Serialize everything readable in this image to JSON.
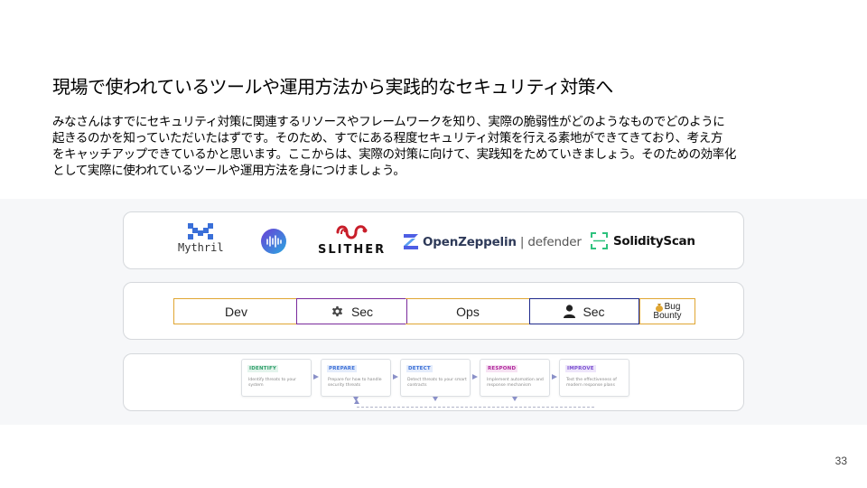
{
  "slide": {
    "title": "現場で使われているツールや運用方法から実践的なセキュリティ対策へ",
    "body_lines": [
      "みなさんはすでにセキュリティ対策に関連するリソースやフレームワークを知り、実際の脆弱性がどのようなものでどのように",
      "起きるのかを知っていただいたはずです。そのため、すでにある程度セキュリティ対策を行える素地ができてきており、考え方",
      "をキャッチアップできているかと思います。ここからは、実際の対策に向けて、実践知をためていきましょう。そのための効率化",
      "として実際に使われているツールや運用方法を身につけましょう。"
    ],
    "page_number": "33"
  },
  "tools": {
    "mythril": {
      "label": "Mythril",
      "icon": "mythril-logo-icon",
      "color": "#3a6fd8"
    },
    "circle_tool": {
      "icon": "wave-circle-logo-icon",
      "color": "#4a5ad0"
    },
    "slither": {
      "label": "SLITHER",
      "icon": "slither-snake-logo-icon",
      "color": "#c81e2a"
    },
    "openzeppelin": {
      "name": "OpenZeppelin",
      "separator": "|",
      "suffix": "defender",
      "icon": "openzeppelin-z-logo-icon",
      "color": "#4e5ee4"
    },
    "solidityscan": {
      "name": "SolidityScan",
      "icon": "solidityscan-frame-logo-icon",
      "color": "#2ec27e"
    }
  },
  "devsecops": {
    "dev": "Dev",
    "sec1": "Sec",
    "sec1_icon": "gear-icon",
    "ops": "Ops",
    "sec2": "Sec",
    "sec2_icon": "person-icon",
    "bug_line1": "Bug",
    "bug_line2": "Bounty",
    "bug_icon": "money-bag-icon"
  },
  "process": {
    "steps": [
      {
        "tag": "IDENTIFY",
        "desc": "Identify threats to your system",
        "color": "#2f9e6a",
        "bg": "#e3f4ec"
      },
      {
        "tag": "PREPARE",
        "desc": "Prepare for how to handle security threats",
        "color": "#3b6fd6",
        "bg": "#e4ecfb"
      },
      {
        "tag": "DETECT",
        "desc": "Detect threats to your smart contracts",
        "color": "#3b6fd6",
        "bg": "#e4ecfb"
      },
      {
        "tag": "RESPOND",
        "desc": "Implement automation and response mechanism",
        "color": "#b0289c",
        "bg": "#f7e2f3"
      },
      {
        "tag": "IMPROVE",
        "desc": "Test the effectiveness of modern response plans",
        "color": "#7a4fd0",
        "bg": "#ede5fa"
      }
    ],
    "accent": "#8a90c8"
  }
}
